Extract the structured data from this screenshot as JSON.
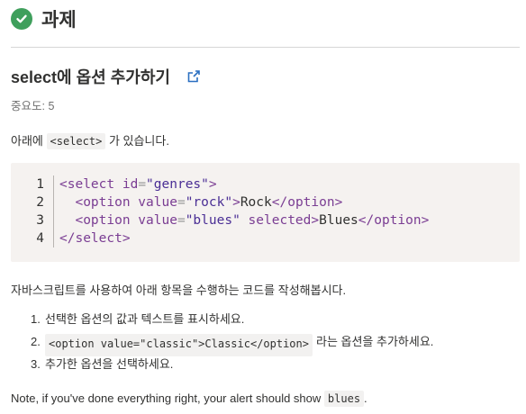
{
  "header": {
    "title": "과제",
    "check_color": "#3f9f5c"
  },
  "task": {
    "title": "select에 옵션 추가하기",
    "importance": "중요도: 5"
  },
  "intro": {
    "prefix": "아래에",
    "code": "<select>",
    "suffix": "가 있습니다."
  },
  "code_block": {
    "line_numbers": [
      "1",
      "2",
      "3",
      "4"
    ],
    "line1": {
      "open": "<select",
      "attr": " id",
      "eq": "=",
      "val": "\"genres\"",
      "close": ">"
    },
    "line2": {
      "open": "<option",
      "attr": " value",
      "eq": "=",
      "val": "\"rock\"",
      "close": ">",
      "text": "Rock",
      "end": "</option>"
    },
    "line3": {
      "open": "<option",
      "attr": " value",
      "eq": "=",
      "val": "\"blues\"",
      "attr2": " selected",
      "close": ">",
      "text": "Blues",
      "end": "</option>"
    },
    "line4": {
      "end": "</select>"
    }
  },
  "instruction": "자바스크립트를 사용하여 아래 항목을 수행하는 코드를 작성해봅시다.",
  "steps": {
    "s1": {
      "num": "1.",
      "text": "선택한 옵션의 값과 텍스트를 표시하세요."
    },
    "s2": {
      "num": "2.",
      "code": "<option value=\"classic\">Classic</option>",
      "text": "라는 옵션을 추가하세요."
    },
    "s3": {
      "num": "3.",
      "text": "추가한 옵션을 선택하세요."
    }
  },
  "note": {
    "text": "Note, if you've done everything right, your alert should show",
    "code": "blues",
    "end": "."
  }
}
